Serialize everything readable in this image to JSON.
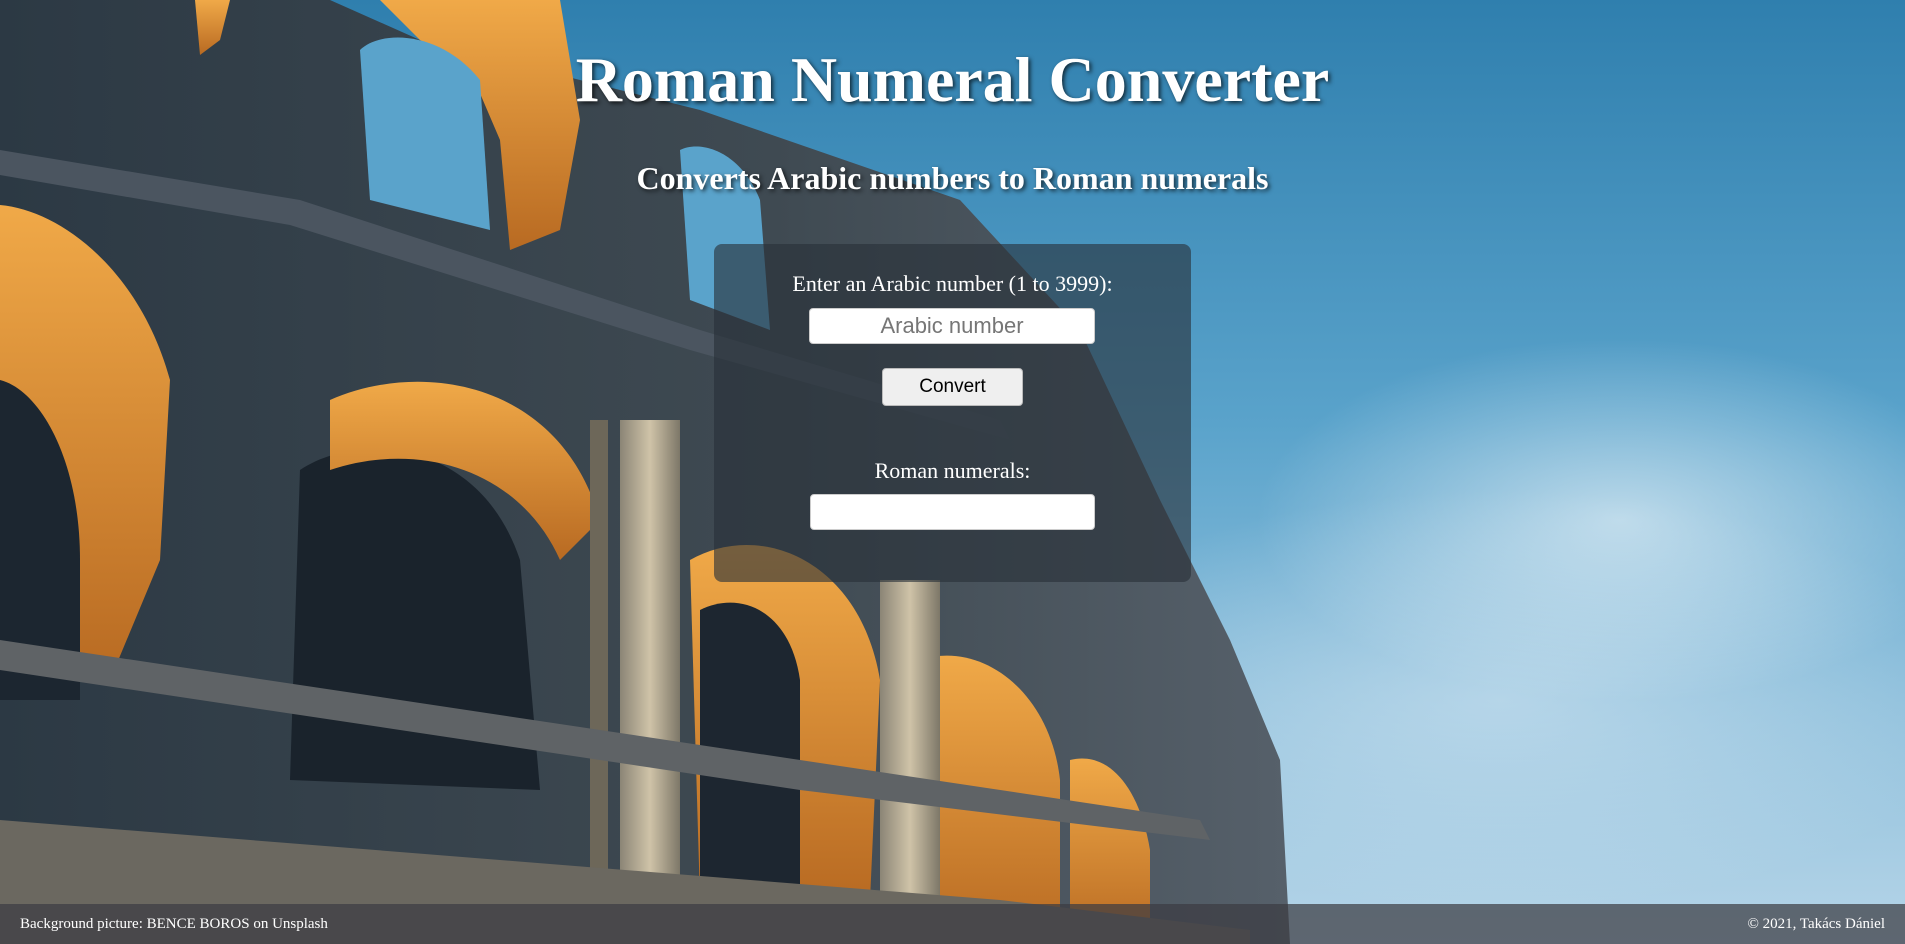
{
  "header": {
    "title": "Roman Numeral Converter",
    "subtitle": "Converts Arabic numbers to Roman numerals"
  },
  "converter": {
    "input_label": "Enter an Arabic number (1 to 3999):",
    "input_placeholder": "Arabic number",
    "input_value": "",
    "button_label": "Convert",
    "output_label": "Roman numerals:",
    "output_value": ""
  },
  "footer": {
    "credit": "Background picture: BENCE BOROS on Unsplash",
    "copyright": "© 2021, Takács Dániel"
  },
  "colors": {
    "panel_bg": "#283038",
    "sky": "#4f9bc6",
    "stone": "#3a4650",
    "lit_stone": "#e39a3a"
  },
  "background": {
    "subject": "colosseum-arches-against-sky"
  }
}
